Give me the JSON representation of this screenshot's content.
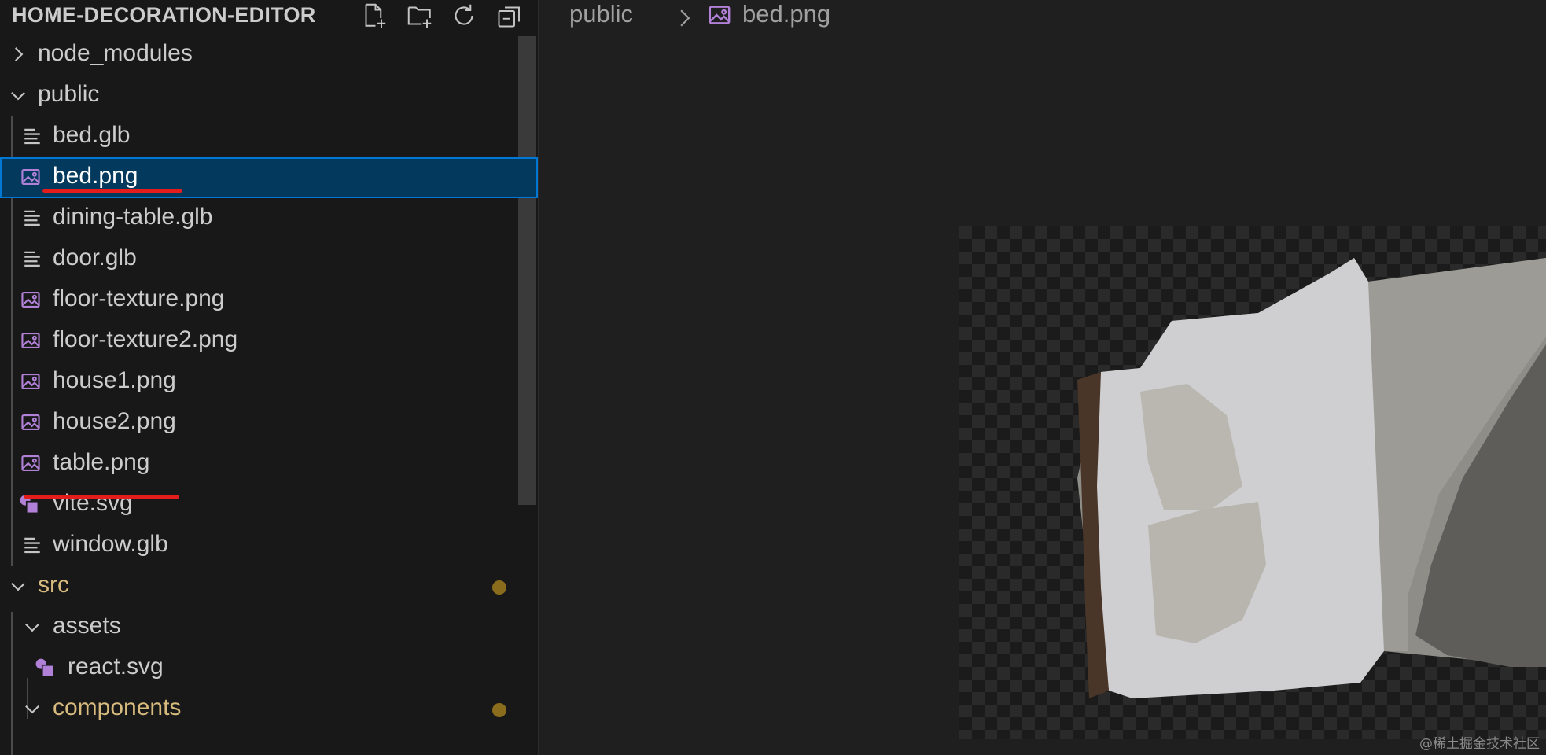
{
  "explorer": {
    "title": "HOME-DECORATION-EDITOR",
    "header_actions": [
      {
        "name": "new-file-icon"
      },
      {
        "name": "new-folder-icon"
      },
      {
        "name": "refresh-icon"
      },
      {
        "name": "collapse-all-icon"
      }
    ],
    "tree": [
      {
        "label": "node_modules",
        "type": "folder",
        "expanded": false,
        "depth": 0
      },
      {
        "label": "public",
        "type": "folder",
        "expanded": true,
        "depth": 0
      },
      {
        "label": "bed.glb",
        "type": "file",
        "icon": "lines-file-icon",
        "depth": 1
      },
      {
        "label": "bed.png",
        "type": "file",
        "icon": "image-file-icon",
        "depth": 1,
        "selected": true
      },
      {
        "label": "dining-table.glb",
        "type": "file",
        "icon": "lines-file-icon",
        "depth": 1
      },
      {
        "label": "door.glb",
        "type": "file",
        "icon": "lines-file-icon",
        "depth": 1
      },
      {
        "label": "floor-texture.png",
        "type": "file",
        "icon": "image-file-icon",
        "depth": 1
      },
      {
        "label": "floor-texture2.png",
        "type": "file",
        "icon": "image-file-icon",
        "depth": 1
      },
      {
        "label": "house1.png",
        "type": "file",
        "icon": "image-file-icon",
        "depth": 1
      },
      {
        "label": "house2.png",
        "type": "file",
        "icon": "image-file-icon",
        "depth": 1
      },
      {
        "label": "table.png",
        "type": "file",
        "icon": "image-file-icon",
        "depth": 1
      },
      {
        "label": "vite.svg",
        "type": "file",
        "icon": "svg-file-icon",
        "depth": 1
      },
      {
        "label": "window.glb",
        "type": "file",
        "icon": "lines-file-icon",
        "depth": 1
      },
      {
        "label": "src",
        "type": "folder",
        "expanded": true,
        "depth": 0,
        "modified": true
      },
      {
        "label": "assets",
        "type": "folder",
        "expanded": true,
        "depth": 1
      },
      {
        "label": "react.svg",
        "type": "file",
        "icon": "svg-file-icon",
        "depth": 2
      },
      {
        "label": "components",
        "type": "folder",
        "expanded": true,
        "depth": 1,
        "modified": true
      }
    ]
  },
  "editor": {
    "breadcrumb": {
      "folder": "public",
      "file": "bed.png"
    },
    "preview_of": "bed.png"
  },
  "watermark": "@稀土掘金技术社区",
  "colors": {
    "sidebar_bg": "#181818",
    "editor_bg": "#1f1f1f",
    "selection_bg": "#04395e",
    "selection_border": "#0078d4",
    "modified_text": "#d7ba7d",
    "image_icon": "#b180d7",
    "annotation_red": "#e51c1c"
  }
}
